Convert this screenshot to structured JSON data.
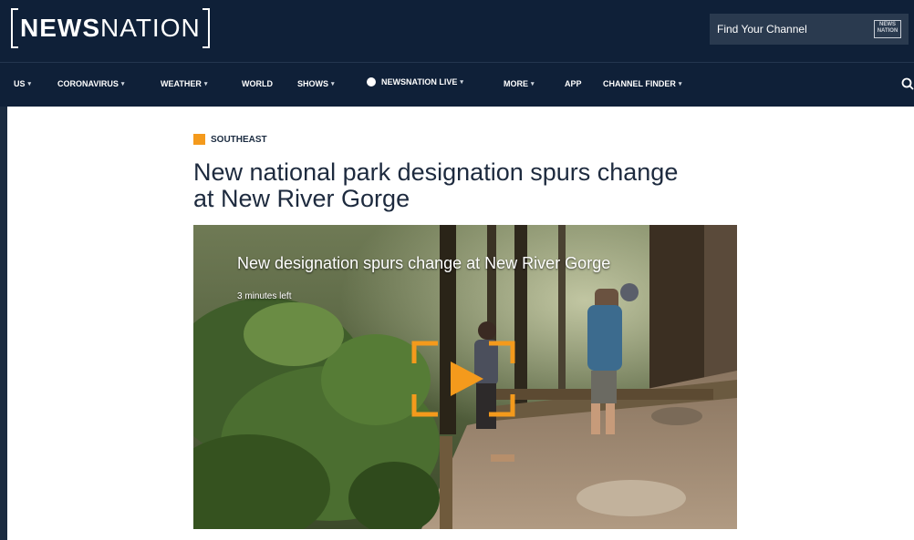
{
  "header": {
    "logo_bold": "NEWS",
    "logo_thin": "NATION",
    "find_channel": "Find Your Channel",
    "badge_line1": "NEWS",
    "badge_line2": "NATION"
  },
  "nav": [
    {
      "label": "US",
      "dropdown": true
    },
    {
      "label": "CORONAVIRUS",
      "dropdown": true
    },
    {
      "label": "WEATHER",
      "dropdown": true
    },
    {
      "label": "WORLD",
      "dropdown": false
    },
    {
      "label": "SHOWS",
      "dropdown": true
    },
    {
      "label": "NEWSNATION LIVE",
      "dropdown": true
    },
    {
      "label": "MORE",
      "dropdown": true
    },
    {
      "label": "APP",
      "dropdown": false
    },
    {
      "label": "CHANNEL FINDER",
      "dropdown": true
    }
  ],
  "article": {
    "category": "SOUTHEAST",
    "headline": "New national park designation spurs change at New River Gorge"
  },
  "video": {
    "title": "New designation spurs change at New River Gorge",
    "time_left": "3 minutes left"
  },
  "colors": {
    "accent": "#f49a1c",
    "nav_bg": "#0f2038",
    "text_dark": "#1d2a3e"
  },
  "icons": {
    "search": "search-icon",
    "play": "play-icon"
  }
}
